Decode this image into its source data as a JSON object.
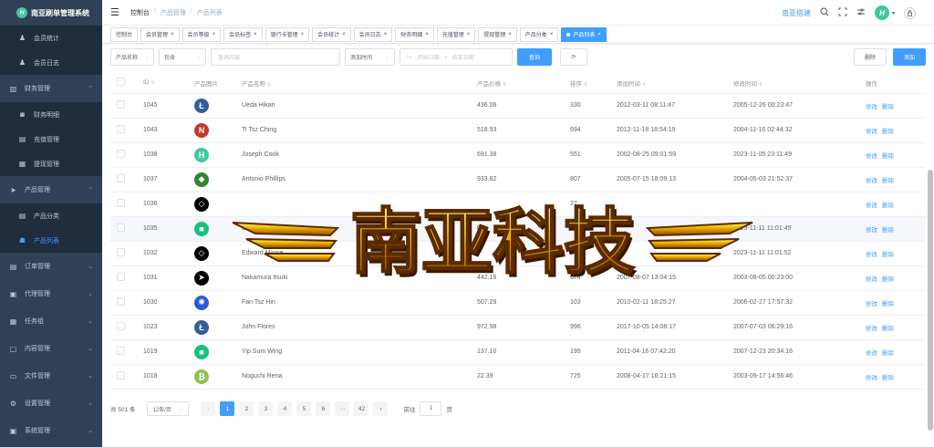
{
  "app": {
    "title": "南亚刷单管理系统",
    "logo_letter": "H"
  },
  "sidebar": {
    "items": [
      {
        "label": "会员统计",
        "icon": "user-icon",
        "type": "sub",
        "active": false
      },
      {
        "label": "会员日志",
        "icon": "user-icon",
        "type": "sub",
        "active": false
      },
      {
        "label": "财务管理",
        "icon": "chart-icon",
        "type": "group",
        "active": false
      },
      {
        "label": "财务明细",
        "icon": "money-icon",
        "type": "sub",
        "active": false
      },
      {
        "label": "充值管理",
        "icon": "wallet-icon",
        "type": "sub",
        "active": false
      },
      {
        "label": "提现管理",
        "icon": "withdraw-icon",
        "type": "sub",
        "active": false
      },
      {
        "label": "产品管理",
        "icon": "send-icon",
        "type": "group",
        "active": false
      },
      {
        "label": "产品分类",
        "icon": "doc-icon",
        "type": "sub",
        "active": false
      },
      {
        "label": "产品列表",
        "icon": "list-icon",
        "type": "sub",
        "active": true
      },
      {
        "label": "订单管理",
        "icon": "order-icon",
        "type": "group",
        "active": false
      },
      {
        "label": "代理管理",
        "icon": "agent-icon",
        "type": "group",
        "active": false
      },
      {
        "label": "任务组",
        "icon": "task-icon",
        "type": "group",
        "active": false
      },
      {
        "label": "内容管理",
        "icon": "content-icon",
        "type": "group",
        "active": false
      },
      {
        "label": "文件管理",
        "icon": "folder-icon",
        "type": "group",
        "active": false
      },
      {
        "label": "设置管理",
        "icon": "settings-icon",
        "type": "group",
        "active": false
      },
      {
        "label": "系统管理",
        "icon": "system-icon",
        "type": "group",
        "active": false
      }
    ]
  },
  "navbar": {
    "breadcrumb": [
      "控制台",
      "产品管理",
      "产品列表"
    ],
    "brand": "南亚搭建",
    "avatar_letter": "H"
  },
  "tags": [
    {
      "label": "控制台",
      "active": false
    },
    {
      "label": "会员管理",
      "active": false
    },
    {
      "label": "会员等级",
      "active": false
    },
    {
      "label": "会员标签",
      "active": false
    },
    {
      "label": "银行卡管理",
      "active": false
    },
    {
      "label": "会员统计",
      "active": false
    },
    {
      "label": "会员日志",
      "active": false
    },
    {
      "label": "财务明细",
      "active": false
    },
    {
      "label": "充值管理",
      "active": false
    },
    {
      "label": "提现管理",
      "active": false
    },
    {
      "label": "产品分类",
      "active": false
    },
    {
      "label": "产品列表",
      "active": true
    }
  ],
  "filter": {
    "field_select": "产品名称",
    "op_select": "包含",
    "search_placeholder": "查询内容",
    "time_select": "添加时间",
    "start_placeholder": "开始日期",
    "date_sep": "-",
    "end_placeholder": "结束日期",
    "search_button": "查询",
    "delete_button": "删除",
    "add_button": "添加"
  },
  "table": {
    "headers": [
      "ID",
      "产品图片",
      "产品名称",
      "产品价格",
      "排序",
      "添加时间",
      "修改时间",
      "操作"
    ],
    "edit_label": "修改",
    "delete_label": "删除",
    "rows": [
      {
        "id": "1045",
        "icon": "litecoin-icon",
        "color": "#345d9d",
        "glyph": "Ł",
        "name": "Ueda Hikari",
        "price": "436.06",
        "sort": "330",
        "created": "2012-03-11 08:11:47",
        "updated": "2005-12-26 00:23:47",
        "hl": false
      },
      {
        "id": "1043",
        "icon": "nexus-icon",
        "color": "#c0392b",
        "glyph": "N",
        "name": "Ti Tsz Ching",
        "price": "518.93",
        "sort": "694",
        "created": "2012-11-18 18:54:19",
        "updated": "2004-11-16 02:44:32",
        "hl": false
      },
      {
        "id": "1038",
        "icon": "h-logo-icon",
        "color": "#3dc9a0",
        "glyph": "H",
        "name": "Joseph Cook",
        "price": "691.38",
        "sort": "551",
        "created": "2002-08-25 09:01:59",
        "updated": "2023-11-05 23:11:49",
        "hl": false
      },
      {
        "id": "1037",
        "icon": "ethereum-classic-icon",
        "color": "#328332",
        "glyph": "◆",
        "name": "Antonio Phillips",
        "price": "933.82",
        "sort": "807",
        "created": "2005-07-15 18:09:13",
        "updated": "2004-05-03 21:52:37",
        "hl": false
      },
      {
        "id": "1036",
        "icon": "eos-icon",
        "color": "#000000",
        "glyph": "◇",
        "name": "",
        "price": "",
        "sort": "27",
        "created": "",
        "updated": "",
        "hl": false
      },
      {
        "id": "1035",
        "icon": "cube-icon",
        "color": "#17c37b",
        "glyph": "■",
        "name": "Sa",
        "price": "0",
        "sort": "",
        "created": "",
        "updated": "2023-11-11 11:01:45",
        "hl": true
      },
      {
        "id": "1032",
        "icon": "eos-icon",
        "color": "#000000",
        "glyph": "◇",
        "name": "Edward Moore",
        "price": "",
        "sort": "52",
        "created": "",
        "updated": "2023-11-11 11:01:52",
        "hl": false
      },
      {
        "id": "1031",
        "icon": "stellar-icon",
        "color": "#000000",
        "glyph": "➤",
        "name": "Nakamura Itsuki",
        "price": "442.16",
        "sort": "674",
        "created": "2007-08-07 13:04:15",
        "updated": "2003-08-05 00:23:00",
        "hl": false
      },
      {
        "id": "1030",
        "icon": "network-icon",
        "color": "#2a5ada",
        "glyph": "✺",
        "name": "Fan Tsz Hin",
        "price": "507.29",
        "sort": "103",
        "created": "2010-02-11 18:25:27",
        "updated": "2006-02-27 17:57:32",
        "hl": false
      },
      {
        "id": "1023",
        "icon": "litecoin-icon",
        "color": "#345d9d",
        "glyph": "Ł",
        "name": "John Flores",
        "price": "972.98",
        "sort": "996",
        "created": "2017-10-05 14:08:17",
        "updated": "2007-07-03 06:29:16",
        "hl": false
      },
      {
        "id": "1019",
        "icon": "cube-icon",
        "color": "#17c37b",
        "glyph": "■",
        "name": "Yip Sum Wing",
        "price": "137.10",
        "sort": "199",
        "created": "2011-04-16 07:42:20",
        "updated": "2007-12-23 20:34:16",
        "hl": false
      },
      {
        "id": "1018",
        "icon": "bitcoin-icon",
        "color": "#8dc351",
        "glyph": "₿",
        "name": "Noguchi Rena",
        "price": "22.39",
        "sort": "725",
        "created": "2008-04-17 16:21:15",
        "updated": "2003-09-17 14:56:46",
        "hl": false
      }
    ]
  },
  "pagination": {
    "total": "共 501 条",
    "page_size": "12条/页",
    "pages": [
      "1",
      "2",
      "3",
      "4",
      "5",
      "6",
      "···",
      "42"
    ],
    "current": "1",
    "goto_label": "前往",
    "goto_value": "1",
    "goto_suffix": "页"
  },
  "watermark": {
    "text": "南亚科技"
  }
}
